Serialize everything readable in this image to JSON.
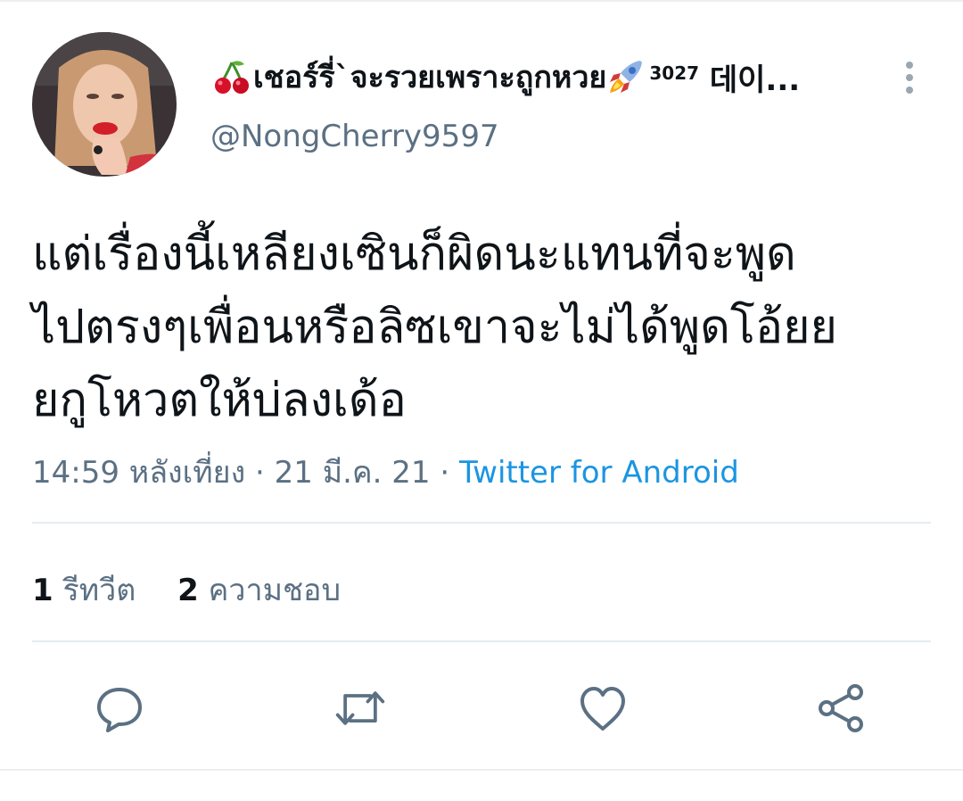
{
  "tweet": {
    "author": {
      "display_name": "เชอร์รี่`จะรวยเพราะถูกหวย",
      "name_suffix_number": "3027",
      "name_suffix_text": "데이...",
      "handle": "@NongCherry9597",
      "name_emojis": [
        "cherry-emoji",
        "rocket-emoji"
      ]
    },
    "text_lines": [
      "แต่เรื่องนี้เหลียงเซินก็ผิดนะแทนที่จะพูด",
      "ไปตรงๆเพื่อนหรือลิซเขาจะไม่ได้พูดโอ้ยย",
      "ยกูโหวตให้บ่ลงเด้อ"
    ],
    "time": "14:59 หลังเที่ยง",
    "date": "21 มี.ค. 21",
    "separator": "·",
    "source": "Twitter for Android",
    "stats": {
      "retweets_count": "1",
      "retweets_label": "รีทวีต",
      "likes_count": "2",
      "likes_label": "ความชอบ"
    },
    "actions": [
      "reply-icon",
      "retweet-icon",
      "like-icon",
      "share-icon"
    ],
    "colors": {
      "text": "#0f1419",
      "secondary": "#5b7083",
      "link": "#1b95e0",
      "divider": "#e6ecf0"
    }
  }
}
